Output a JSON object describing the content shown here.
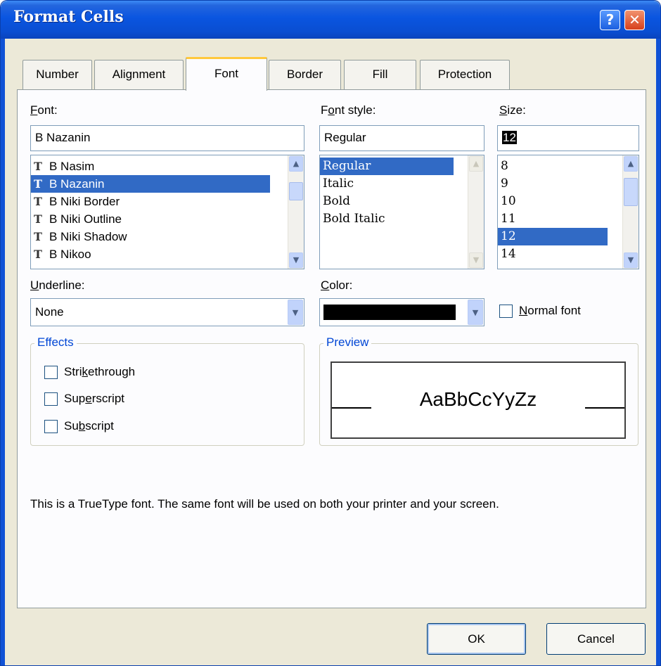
{
  "window": {
    "title": "Format Cells",
    "help_glyph": "?",
    "close_glyph": "✕"
  },
  "tabs": [
    {
      "label_pre": "",
      "label_u": "",
      "label_post": "Number"
    },
    {
      "label_pre": "",
      "label_u": "",
      "label_post": "Alignment"
    },
    {
      "label_pre": "",
      "label_u": "",
      "label_post": "Font"
    },
    {
      "label_pre": "",
      "label_u": "",
      "label_post": "Border"
    },
    {
      "label_pre": "",
      "label_u": "",
      "label_post": "Fill"
    },
    {
      "label_pre": "",
      "label_u": "",
      "label_post": "Protection"
    }
  ],
  "active_tab": "Font",
  "font": {
    "label_u": "F",
    "label_rest": "ont:",
    "value": "B Nazanin",
    "items": [
      "B Nasim",
      "B Nazanin",
      "B Niki Border",
      "B Niki Outline",
      "B Niki Shadow",
      "B Nikoo"
    ],
    "selected": "B Nazanin",
    "tt_glyph": "T"
  },
  "font_style": {
    "label_pre": "F",
    "label_u": "o",
    "label_rest": "nt style:",
    "value": "Regular",
    "items": [
      "Regular",
      "Italic",
      "Bold",
      "Bold Italic"
    ],
    "selected": "Regular"
  },
  "size": {
    "label_u": "S",
    "label_rest": "ize:",
    "value": "12",
    "items": [
      "8",
      "9",
      "10",
      "11",
      "12",
      "14"
    ],
    "selected": "12"
  },
  "underline": {
    "label_u": "U",
    "label_rest": "nderline:",
    "value": "None"
  },
  "color": {
    "label_u": "C",
    "label_rest": "olor:",
    "swatch": "#000000"
  },
  "normal_font": {
    "label_u": "N",
    "label_rest": "ormal font",
    "checked": false
  },
  "effects": {
    "title": "Effects",
    "options": [
      {
        "pre": "Stri",
        "u": "k",
        "post": "ethrough",
        "checked": false
      },
      {
        "pre": "Sup",
        "u": "e",
        "post": "rscript",
        "checked": false
      },
      {
        "pre": "Su",
        "u": "b",
        "post": "script",
        "checked": false
      }
    ]
  },
  "preview": {
    "title": "Preview",
    "sample": "AaBbCcYyZz"
  },
  "info_text": "This is a TrueType font.  The same font will be used on both your printer and your screen.",
  "buttons": {
    "ok": "OK",
    "cancel": "Cancel"
  },
  "colors": {
    "titlebar": "#0A55E0",
    "selection": "#316AC5",
    "dialog_bg": "#ECE9D8",
    "active_tab_accent": "#FFC83C",
    "group_title": "#0046D5"
  }
}
